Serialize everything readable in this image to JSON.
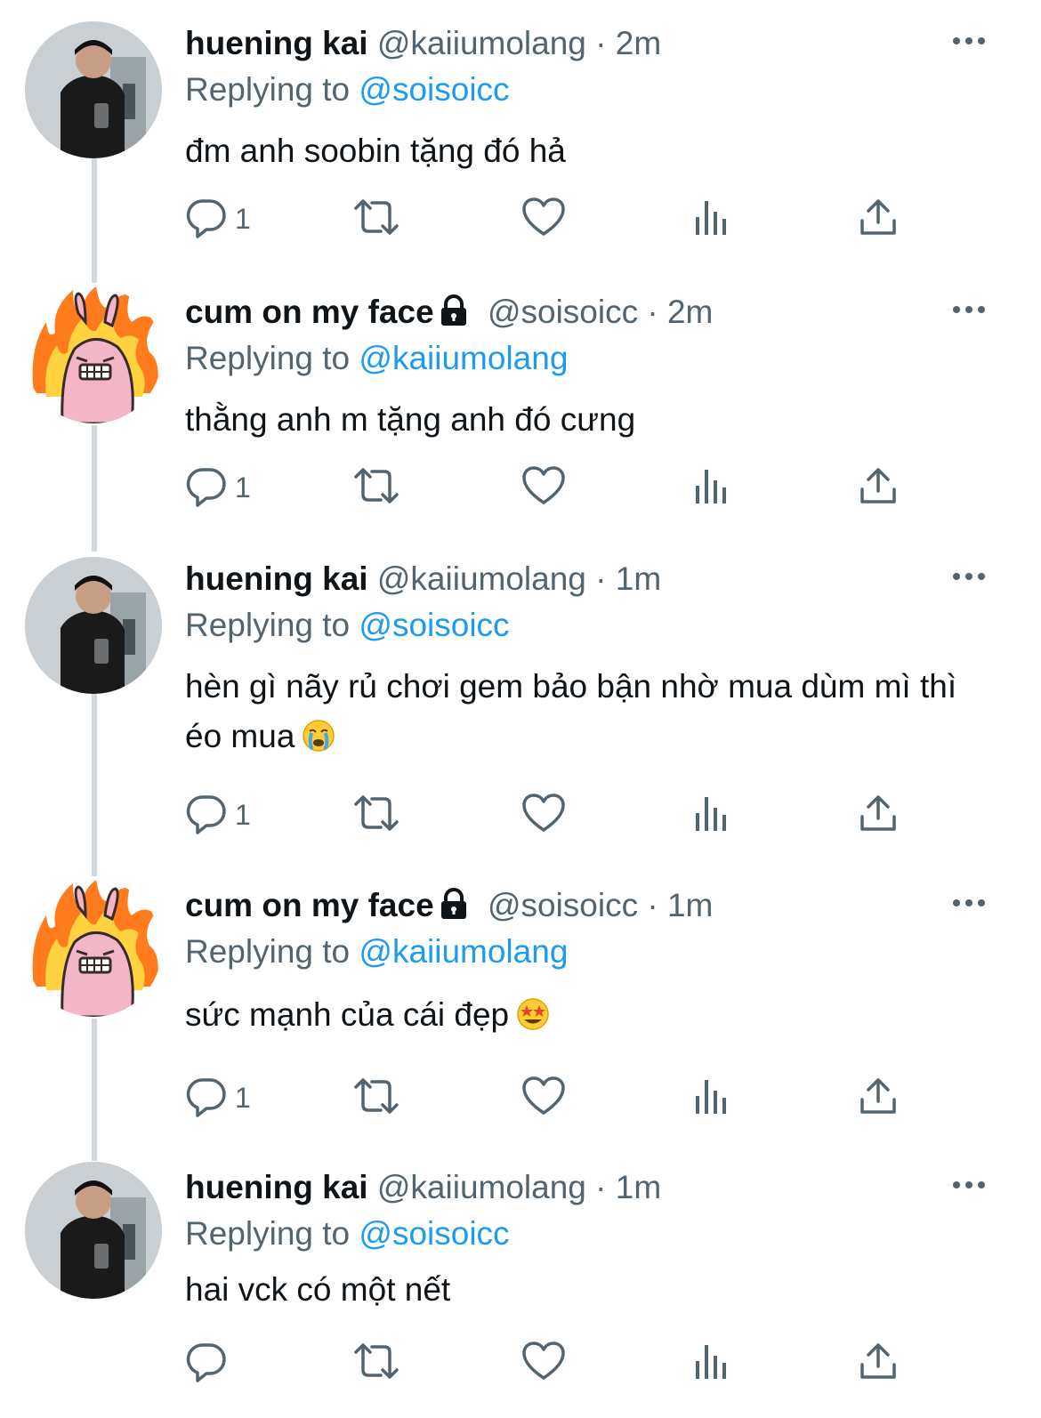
{
  "tweets": [
    {
      "name": "huening kai",
      "handle": "@kaiiumolang",
      "time": "2m",
      "replying_prefix": "Replying to",
      "replying_to": "@soisoicc",
      "text": "đm anh soobin tặng đó hả",
      "emoji": "",
      "reply_count": "1",
      "locked": false
    },
    {
      "name": "cum on my face",
      "handle": "@soisoicc",
      "time": "2m",
      "replying_prefix": "Replying to",
      "replying_to": "@kaiiumolang",
      "text": "thằng anh m tặng anh đó cưng",
      "emoji": "",
      "reply_count": "1",
      "locked": true
    },
    {
      "name": "huening kai",
      "handle": "@kaiiumolang",
      "time": "1m",
      "replying_prefix": "Replying to",
      "replying_to": "@soisoicc",
      "text": "hèn gì nãy rủ chơi gem bảo bận nhờ mua dùm mì thì éo mua",
      "emoji": "crying-face-emoji",
      "reply_count": "1",
      "locked": false
    },
    {
      "name": "cum on my face",
      "handle": "@soisoicc",
      "time": "1m",
      "replying_prefix": "Replying to",
      "replying_to": "@kaiiumolang",
      "text": "sức mạnh của cái đẹp",
      "emoji": "star-struck-emoji",
      "reply_count": "1",
      "locked": true
    },
    {
      "name": "huening kai",
      "handle": "@kaiiumolang",
      "time": "1m",
      "replying_prefix": "Replying to",
      "replying_to": "@soisoicc",
      "text": "hai vck có một nết",
      "emoji": "",
      "reply_count": "",
      "locked": false
    }
  ],
  "colors": {
    "text": "#0f1419",
    "secondary": "#536471",
    "link": "#1d9bf0",
    "thread_line": "#cfd9de"
  },
  "icons": [
    "reply-icon",
    "retweet-icon",
    "like-icon",
    "views-icon",
    "share-icon",
    "more-icon",
    "lock-icon"
  ]
}
